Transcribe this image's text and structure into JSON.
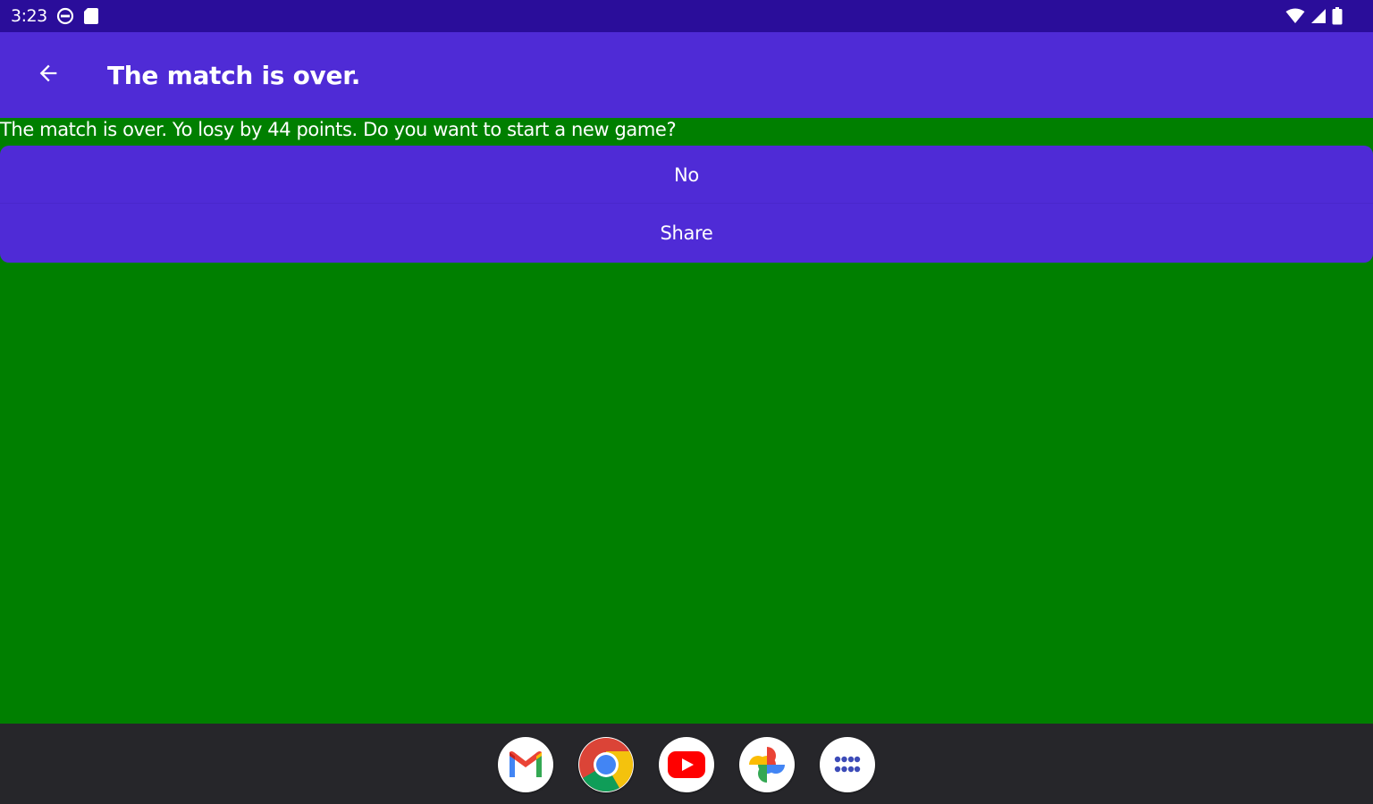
{
  "status_bar": {
    "time": "3:23",
    "icons": [
      "do-not-disturb-icon",
      "sd-card-icon",
      "wifi-icon",
      "signal-icon",
      "battery-icon"
    ]
  },
  "app_bar": {
    "title": "The match is over.",
    "back_icon": "back-arrow-icon"
  },
  "content": {
    "message": "The match is over. Yo losy by 44 points. Do you want to start a new game?",
    "buttons": [
      {
        "label": "No"
      },
      {
        "label": "Share"
      }
    ]
  },
  "taskbar": {
    "apps": [
      {
        "icon": "gmail-icon"
      },
      {
        "icon": "chrome-icon"
      },
      {
        "icon": "youtube-icon"
      },
      {
        "icon": "photos-icon"
      },
      {
        "icon": "app-drawer-icon"
      }
    ]
  },
  "colors": {
    "status_bar": "#2a0d9a",
    "accent": "#4f2bd6",
    "background": "#007f00",
    "taskbar": "#26262a"
  }
}
